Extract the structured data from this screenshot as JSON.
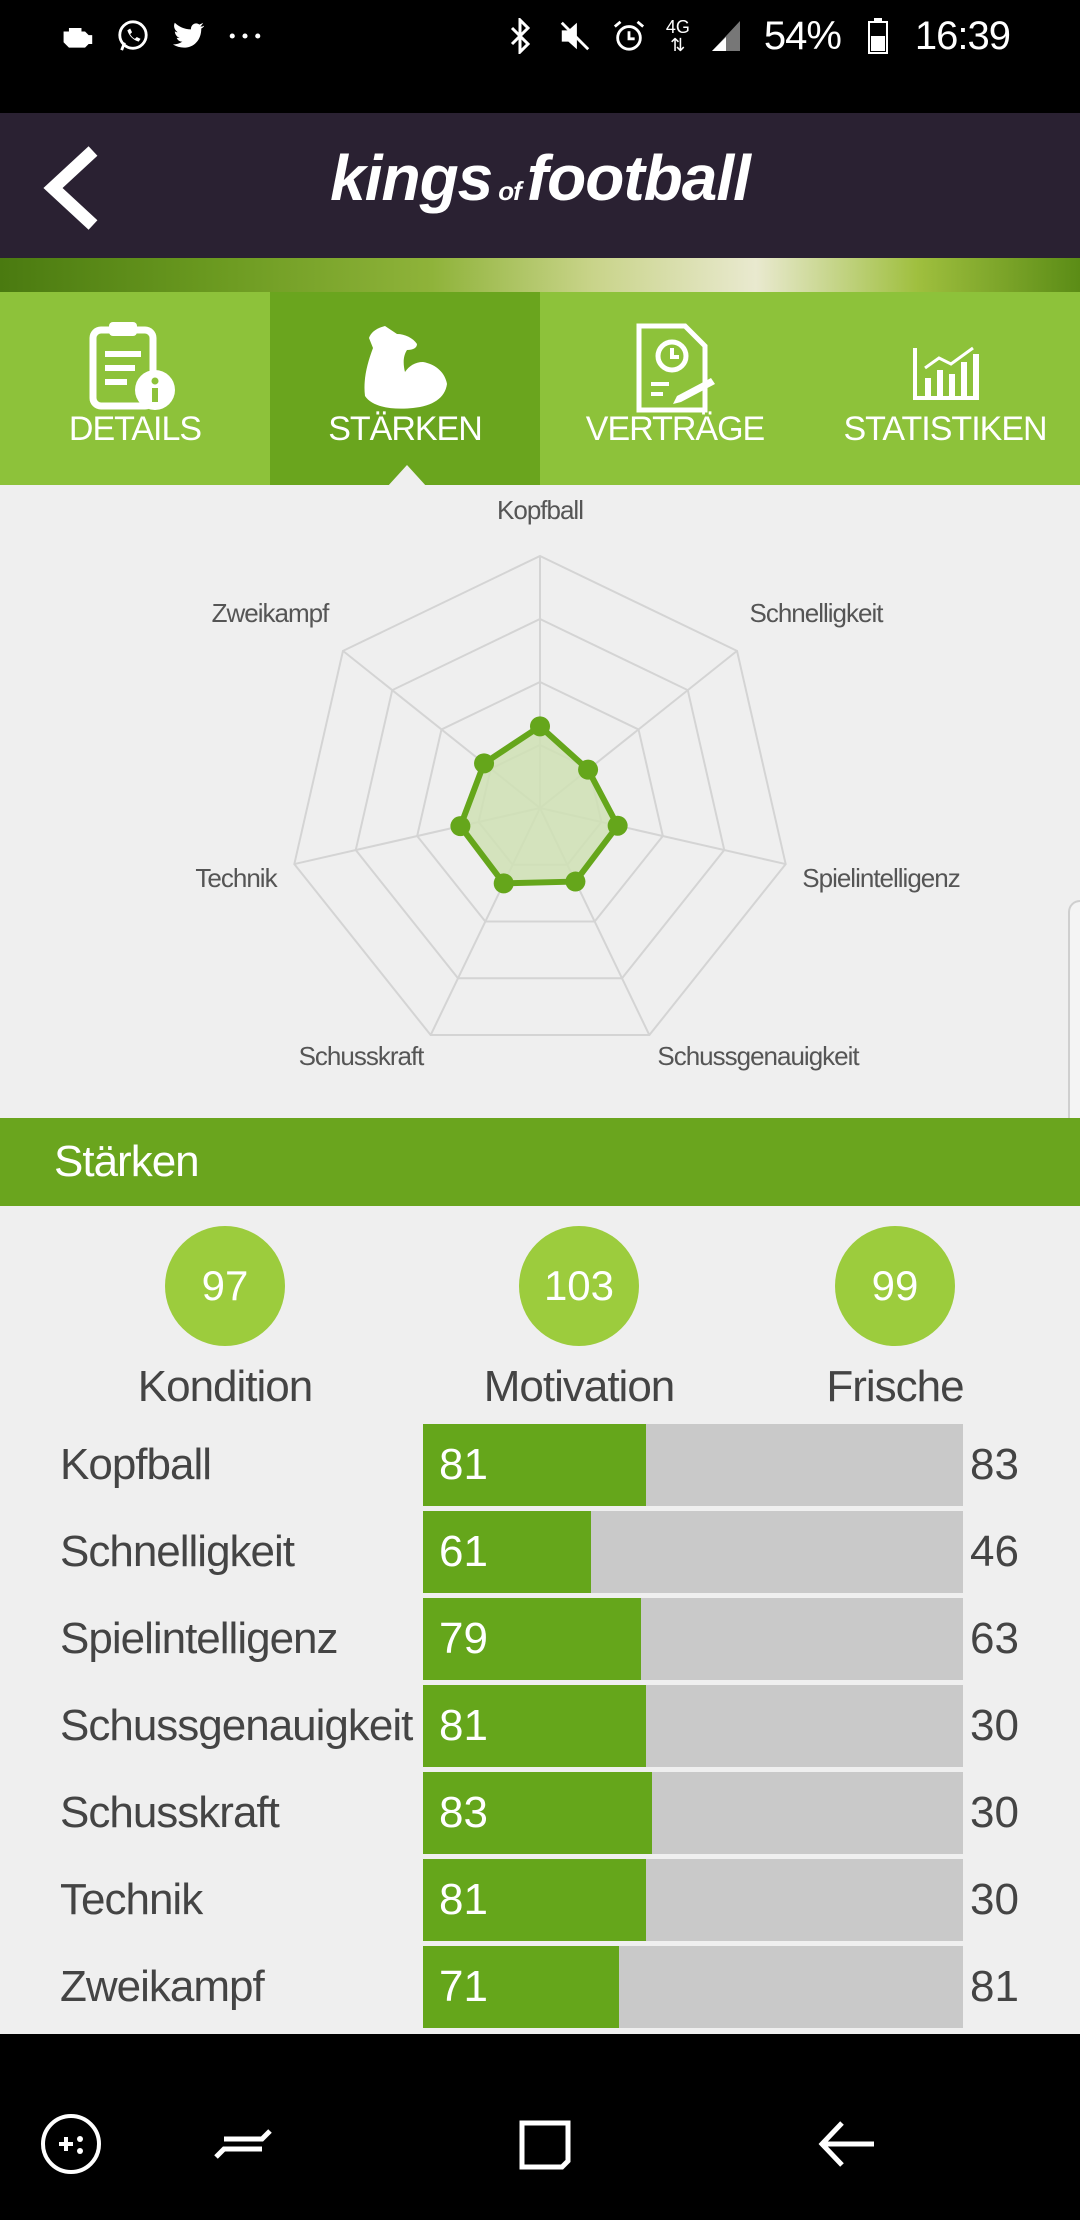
{
  "status_bar": {
    "left_icons": [
      "engine-icon",
      "whatsapp-icon",
      "twitter-icon",
      "more-dots-icon"
    ],
    "right_icons": [
      "bluetooth-icon",
      "mute-icon",
      "alarm-icon",
      "4g-signal-icon",
      "signal-icon",
      "battery-icon"
    ],
    "network": "4G",
    "battery": "54%",
    "time": "16:39"
  },
  "header": {
    "logo_part1": "kings",
    "logo_of": "of",
    "logo_part2": "football"
  },
  "tabs": [
    {
      "label": "DETAILS",
      "icon": "document-info-icon",
      "active": false
    },
    {
      "label": "STÄRKEN",
      "icon": "flexed-bicep-icon",
      "active": true
    },
    {
      "label": "VERTRÄGE",
      "icon": "contract-clock-icon",
      "active": false
    },
    {
      "label": "STATISTIKEN",
      "icon": "bar-chart-icon",
      "active": false
    }
  ],
  "chart_data": {
    "type": "radar",
    "axes": [
      "Kopfball",
      "Schnelligkeit",
      "Spielintelligenz",
      "Schussgenauigkeit",
      "Schusskraft",
      "Technik",
      "Zweikampf"
    ],
    "values": [
      81,
      61,
      79,
      81,
      83,
      81,
      71
    ],
    "rmax": 250,
    "grid_levels": 4,
    "series_color": "#65a61b",
    "fill_color": "#cfe0b4"
  },
  "section": {
    "title": "Stärken"
  },
  "summary": [
    {
      "value": "97",
      "label": "Kondition"
    },
    {
      "value": "103",
      "label": "Motivation"
    },
    {
      "value": "99",
      "label": "Frische"
    }
  ],
  "bar_scale_max": 196,
  "strengths": [
    {
      "name": "Kopfball",
      "value": 81,
      "potential": "83"
    },
    {
      "name": "Schnelligkeit",
      "value": 61,
      "potential": "46"
    },
    {
      "name": "Spielintelligenz",
      "value": 79,
      "potential": "63"
    },
    {
      "name": "Schussgenauigkeit",
      "value": 81,
      "potential": "30"
    },
    {
      "name": "Schusskraft",
      "value": 83,
      "potential": "30"
    },
    {
      "name": "Technik",
      "value": 81,
      "potential": "30"
    },
    {
      "name": "Zweikampf",
      "value": 71,
      "potential": "81"
    }
  ],
  "nav_icons": [
    "game-launcher-icon",
    "recent-apps-icon",
    "home-icon",
    "back-icon"
  ]
}
